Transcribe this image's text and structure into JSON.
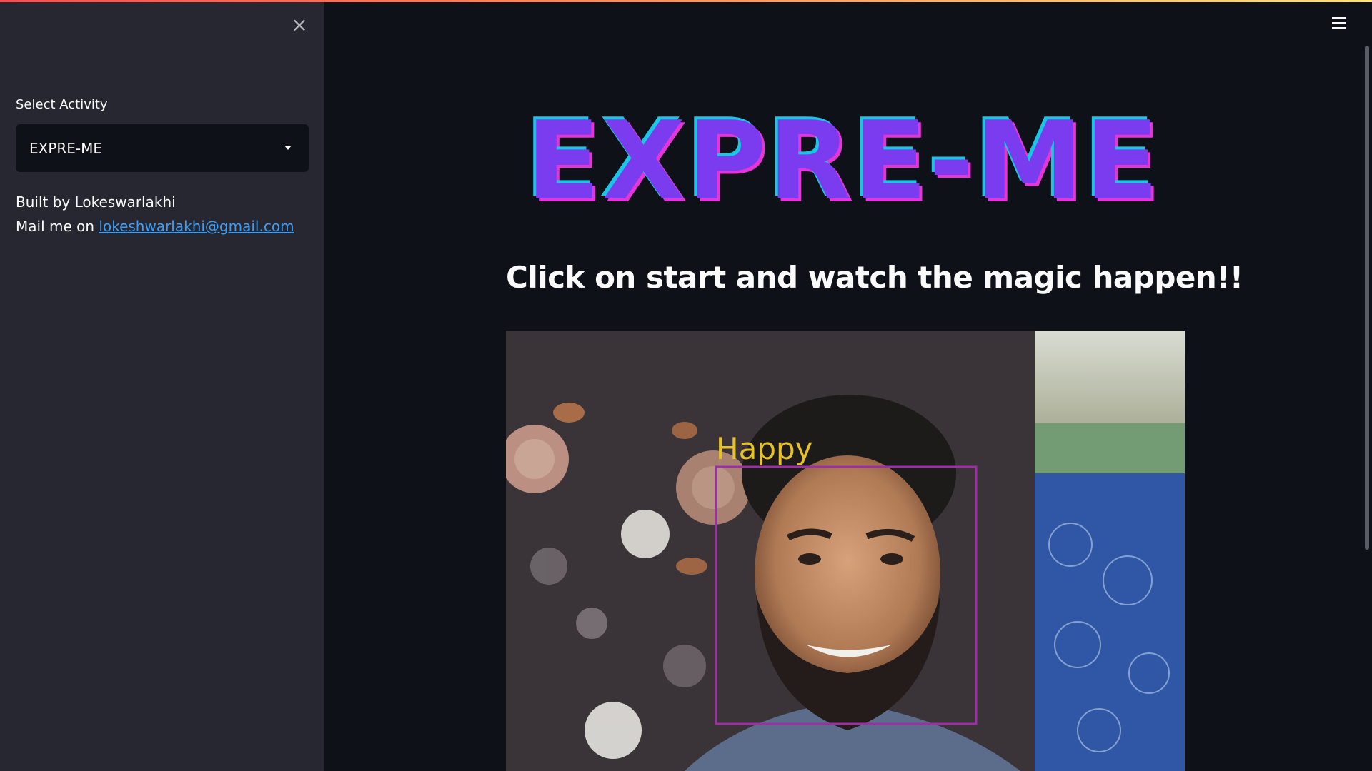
{
  "sidebar": {
    "close_icon": "close-icon",
    "select_label": "Select Activity",
    "select_value": "EXPRE-ME",
    "built_by": "Built by Lokeswarlakhi",
    "mail_prefix": "Mail me on ",
    "mail_link": "lokeshwarlakhi@gmail.com"
  },
  "header": {
    "menu_icon": "hamburger-menu-icon"
  },
  "main": {
    "logo_text": "EXPRE-ME",
    "heading": "Click on start and watch the magic happen!!",
    "video": {
      "emotion_label": "Happy",
      "label_color": "#e6c12a",
      "box_color": "#9b2fa3"
    }
  },
  "colors": {
    "background": "#0e1117",
    "sidebar": "#262730",
    "link": "#3d9df3",
    "logo_fill": "#7b3cf0",
    "logo_shadow": "#e535d6",
    "logo_highlight": "#19c6e6"
  }
}
